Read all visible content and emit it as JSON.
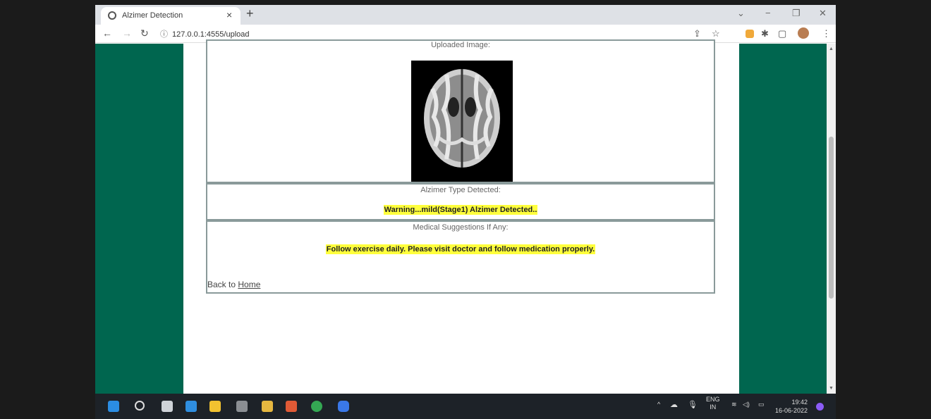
{
  "browser": {
    "tab_title": "Alzimer Detection",
    "tab_close": "×",
    "new_tab": "+",
    "url": "127.0.0.1:4555/upload",
    "win_min": "−",
    "win_max": "❐",
    "win_close": "✕",
    "win_dropdown": "⌄"
  },
  "page": {
    "uploaded_label": "Uploaded Image:",
    "type_label": "Alzimer Type Detected:",
    "result_text": "Warning...mild(Stage1) Alzimer Detected..",
    "suggest_label": "Medical Suggestions If Any:",
    "suggestion_text": "Follow exercise daily. Please visit doctor and follow medication properly.",
    "back_prefix": "Back to ",
    "back_link": "Home"
  },
  "taskbar": {
    "lang_top": "ENG",
    "lang_bottom": "IN",
    "time": "19:42",
    "date": "16-06-2022",
    "tray_chevron": "^"
  },
  "colors": {
    "side_panel": "#00664f",
    "highlight": "#ffff3c"
  }
}
